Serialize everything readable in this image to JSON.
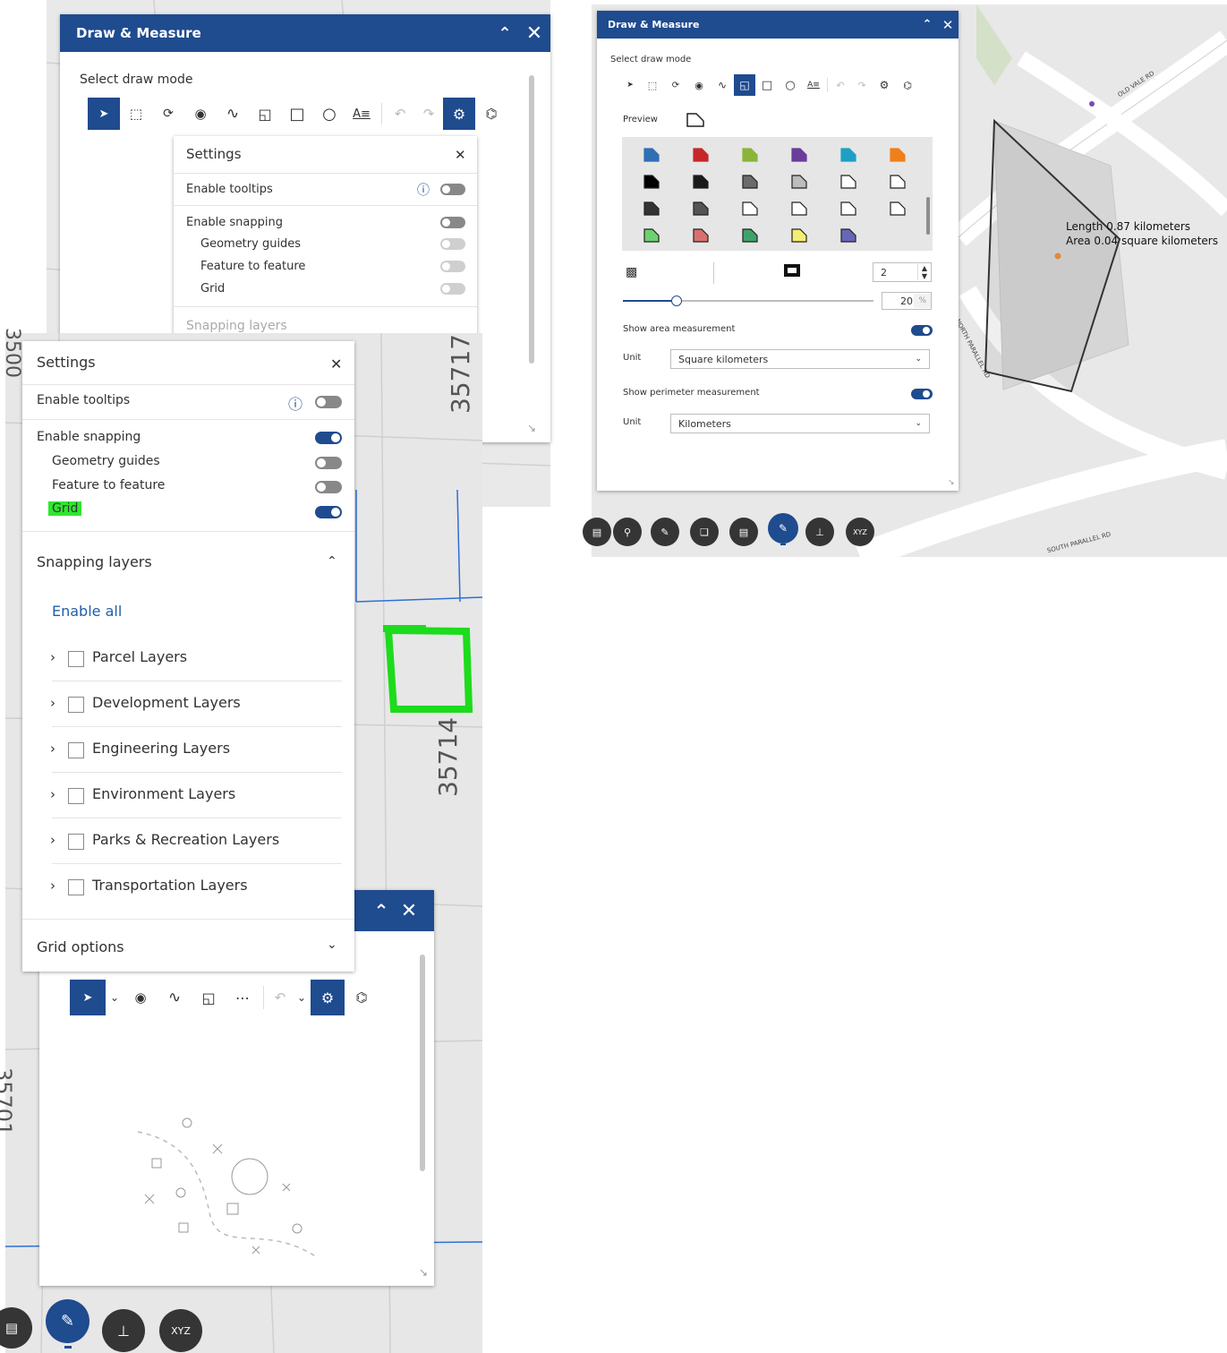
{
  "panelA": {
    "title": "Draw & Measure",
    "select_draw_mode": "Select draw mode"
  },
  "settingsA": {
    "title": "Settings",
    "enable_tooltips": "Enable tooltips",
    "enable_snapping": "Enable snapping",
    "geometry_guides": "Geometry guides",
    "feature_to_feature": "Feature to feature",
    "grid": "Grid",
    "snapping_layers": "Snapping layers"
  },
  "settingsB": {
    "title": "Settings",
    "enable_tooltips": "Enable tooltips",
    "enable_snapping": "Enable snapping",
    "geometry_guides": "Geometry guides",
    "feature_to_feature": "Feature to feature",
    "grid": "Grid",
    "snapping_layers": "Snapping layers",
    "enable_all": "Enable all",
    "layers": [
      "Parcel Layers",
      "Development Layers",
      "Engineering Layers",
      "Environment Layers",
      "Parks & Recreation Layers",
      "Transportation Layers"
    ],
    "grid_options": "Grid options"
  },
  "mapLeft": {
    "label_35717": "35717",
    "label_35714": "35714",
    "label_35701": "35701",
    "label_3500": "3500"
  },
  "panelC": {
    "title": "Draw & Measure",
    "select_draw_mode": "Select draw mode",
    "preview": "Preview",
    "stroke_width": "2",
    "opacity": "20",
    "opacity_unit": "%",
    "show_area": "Show area measurement",
    "unit_label": "Unit",
    "area_unit": "Square kilometers",
    "show_perimeter": "Show perimeter measurement",
    "perimeter_unit": "Kilometers",
    "swatch_colors": [
      [
        "#2f6fb3",
        "#c62828",
        "#8bb439",
        "#6a3d9a",
        "#1f9fc6",
        "#ef7f1a"
      ],
      [
        "#000000",
        "#1a1a1a",
        "#6b6b6b",
        "#bcbcbc",
        "#ffffff",
        "#ffffff"
      ],
      [
        "#333333",
        "#555555",
        "#ffffff",
        "#ffffff",
        "#ffffff",
        "#ffffff"
      ],
      [
        "#6fd06f",
        "#d97070",
        "#3ea36b",
        "#f3ee74",
        "#6767b8"
      ]
    ],
    "opacity_slider": 0.2
  },
  "mapRight": {
    "measure_length": "Length 0.87 kilometers",
    "measure_area": "Area 0.04 square kilometers",
    "road_old_vale": "OLD VALE RD",
    "road_north_parallel": "NORTH PARALLEL RD",
    "road_south_parallel": "SOUTH PARALLEL RD",
    "xyz_button": "XYZ"
  },
  "toolbarBottom": {
    "xyz_button": "XYZ"
  }
}
